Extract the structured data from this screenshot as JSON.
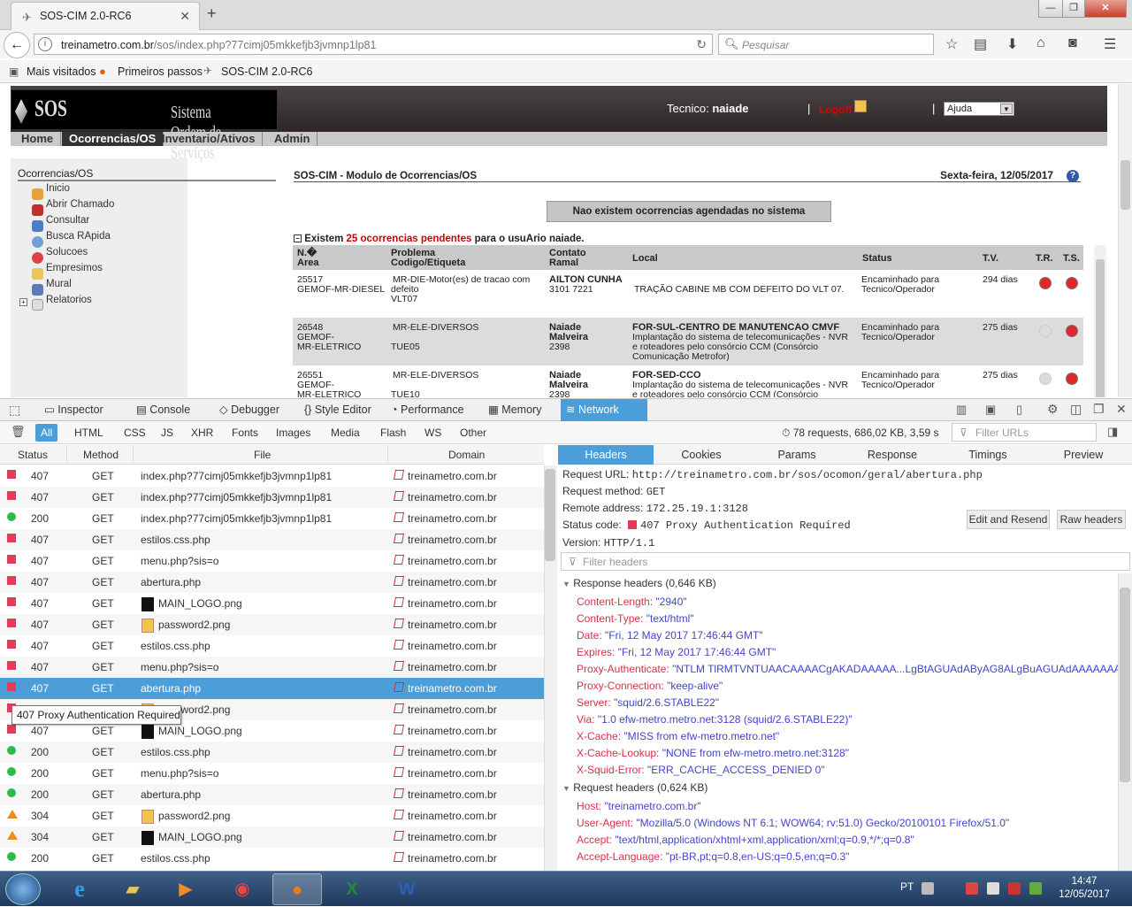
{
  "browser": {
    "tab_title": "SOS-CIM 2.0-RC6",
    "url_host": "treinametro.com.br",
    "url_path": "/sos/index.php?77cimj05mkkefjb3jvmnp1lp81",
    "search_placeholder": "Pesquisar",
    "bookmarks": [
      "Mais visitados",
      "Primeiros passos",
      "SOS-CIM 2.0-RC6"
    ]
  },
  "sos": {
    "logo_main": "SOS",
    "logo_sub": "Sistema Ordem de Serviços",
    "tecnico_label": "Tecnico:",
    "tecnico_name": "naiade",
    "sep": "|",
    "logoff": "Logoff",
    "ajuda": "Ajuda",
    "menu": [
      "Home",
      "Ocorrencias/OS",
      "Inventario/Ativos",
      "Admin"
    ],
    "left_title": "Ocorrencias/OS",
    "left_items": [
      "Inicio",
      "Abrir Chamado",
      "Consultar",
      "Busca RApida",
      "Solucoes",
      "Empresimos",
      "Mural",
      "Relatorios"
    ],
    "module_title": "SOS-CIM - Modulo de Ocorrencias/OS",
    "date": "Sexta-feira, 12/05/2017",
    "no_scheduled": "Nao existem ocorrencias agendadas no sistema",
    "existem_pre": "Existem",
    "existem_count": "25 ocorrencias pendentes",
    "existem_post": "para o usuArio naiade.",
    "table_headers": {
      "n": "N.�",
      "area": "Area",
      "problema": "Problema",
      "codigo": "Codigo/Etiqueta",
      "contato": "Contato",
      "ramal": "Ramal",
      "local": "Local",
      "status": "Status",
      "tv": "T.V.",
      "tr": "T.R.",
      "ts": "T.S."
    },
    "rows": [
      {
        "n": "25517",
        "area": "GEMOF-MR-DIESEL",
        "area2": "",
        "problema": "MR-DIE-Motor(es) de tracao com",
        "problema2": "defeito",
        "codigo": "VLT07",
        "contato": "AILTON CUNHA",
        "contato2": "",
        "ramal": "3101 7221",
        "local_title": "",
        "local": "TRAÇÃO CABINE MB COM DEFEITO DO VLT 07.",
        "local2": "",
        "local3": "",
        "status": "Encaminhado para",
        "status2": "Tecnico/Operador",
        "tv": "294 dias",
        "tr": "red",
        "ts": "red"
      },
      {
        "n": "26548",
        "area": "GEMOF-",
        "area2": "MR-ELETRICO",
        "problema": "MR-ELE-DIVERSOS",
        "problema2": "",
        "codigo": "TUE05",
        "contato": "Naiade",
        "contato2": "Malveira",
        "ramal": "2398",
        "local_title": "FOR-SUL-CENTRO DE MANUTENCAO CMVF",
        "local": "Implantação do sistema de telecomunicações - NVR",
        "local2": "e roteadores pelo consórcio CCM (Consórcio",
        "local3": "Comunicação Metrofor)",
        "status": "Encaminhado para",
        "status2": "Tecnico/Operador",
        "tv": "275 dias",
        "tr": "grey",
        "ts": "red"
      },
      {
        "n": "26551",
        "area": "GEMOF-",
        "area2": "MR-ELETRICO",
        "problema": "MR-ELE-DIVERSOS",
        "problema2": "",
        "codigo": "TUE10",
        "contato": "Naiade",
        "contato2": "Malveira",
        "ramal": "2398",
        "local_title": "FOR-SED-CCO",
        "local": "Implantação do sistema de telecomunicações - NVR",
        "local2": "e roteadores pelo consórcio CCM (Consórcio",
        "local3": "",
        "status": "Encaminhado para",
        "status2": "Tecnico/Operador",
        "tv": "275 dias",
        "tr": "grey",
        "ts": "red"
      }
    ]
  },
  "devtools": {
    "tabs": [
      "Inspector",
      "Console",
      "Debugger",
      "Style Editor",
      "Performance",
      "Memory",
      "Network"
    ],
    "filters": [
      "All",
      "HTML",
      "CSS",
      "JS",
      "XHR",
      "Fonts",
      "Images",
      "Media",
      "Flash",
      "WS",
      "Other"
    ],
    "summary": "78 requests, 686,02 KB, 3,59 s",
    "filter_urls_placeholder": "Filter URLs",
    "columns": [
      "Status",
      "Method",
      "File",
      "Domain"
    ],
    "requests": [
      {
        "status": "407",
        "method": "GET",
        "file": "index.php?77cimj05mkkefjb3jvmnp1lp81",
        "icon": "",
        "domain": "treinametro.com.br"
      },
      {
        "status": "407",
        "method": "GET",
        "file": "index.php?77cimj05mkkefjb3jvmnp1lp81",
        "icon": "",
        "domain": "treinametro.com.br"
      },
      {
        "status": "200",
        "method": "GET",
        "file": "index.php?77cimj05mkkefjb3jvmnp1lp81",
        "icon": "",
        "domain": "treinametro.com.br"
      },
      {
        "status": "407",
        "method": "GET",
        "file": "estilos.css.php",
        "icon": "",
        "domain": "treinametro.com.br"
      },
      {
        "status": "407",
        "method": "GET",
        "file": "menu.php?sis=o",
        "icon": "",
        "domain": "treinametro.com.br"
      },
      {
        "status": "407",
        "method": "GET",
        "file": "abertura.php",
        "icon": "",
        "domain": "treinametro.com.br"
      },
      {
        "status": "407",
        "method": "GET",
        "file": "MAIN_LOGO.png",
        "icon": "logo",
        "domain": "treinametro.com.br"
      },
      {
        "status": "407",
        "method": "GET",
        "file": "password2.png",
        "icon": "pw",
        "domain": "treinametro.com.br"
      },
      {
        "status": "407",
        "method": "GET",
        "file": "estilos.css.php",
        "icon": "",
        "domain": "treinametro.com.br"
      },
      {
        "status": "407",
        "method": "GET",
        "file": "menu.php?sis=o",
        "icon": "",
        "domain": "treinametro.com.br"
      },
      {
        "status": "407",
        "method": "GET",
        "file": "abertura.php",
        "icon": "",
        "domain": "treinametro.com.br"
      },
      {
        "status": "407",
        "method": "GET",
        "file": "password2.png",
        "icon": "pw",
        "domain": "treinametro.com.br"
      },
      {
        "status": "407",
        "method": "GET",
        "file": "MAIN_LOGO.png",
        "icon": "logo",
        "domain": "treinametro.com.br"
      },
      {
        "status": "200",
        "method": "GET",
        "file": "estilos.css.php",
        "icon": "",
        "domain": "treinametro.com.br"
      },
      {
        "status": "200",
        "method": "GET",
        "file": "menu.php?sis=o",
        "icon": "",
        "domain": "treinametro.com.br"
      },
      {
        "status": "200",
        "method": "GET",
        "file": "abertura.php",
        "icon": "",
        "domain": "treinametro.com.br"
      },
      {
        "status": "304",
        "method": "GET",
        "file": "password2.png",
        "icon": "pw",
        "domain": "treinametro.com.br"
      },
      {
        "status": "304",
        "method": "GET",
        "file": "MAIN_LOGO.png",
        "icon": "logo",
        "domain": "treinametro.com.br"
      },
      {
        "status": "200",
        "method": "GET",
        "file": "estilos.css.php",
        "icon": "",
        "domain": "treinametro.com.br"
      }
    ],
    "selected_index": 10,
    "tooltip": "407 Proxy Authentication Required",
    "detail_tabs": [
      "Headers",
      "Cookies",
      "Params",
      "Response",
      "Timings",
      "Preview"
    ],
    "request_url_label": "Request URL:",
    "request_url": "http://treinametro.com.br/sos/ocomon/geral/abertura.php",
    "request_method_label": "Request method:",
    "request_method": "GET",
    "remote_address_label": "Remote address:",
    "remote_address": "172.25.19.1:3128",
    "status_code_label": "Status code:",
    "status_code": "407 Proxy Authentication Required",
    "version_label": "Version:",
    "version": "HTTP/1.1",
    "edit_resend": "Edit and Resend",
    "raw_headers": "Raw headers",
    "filter_headers_placeholder": "Filter headers",
    "response_headers_title": "Response headers (0,646 KB)",
    "response_headers": [
      {
        "k": "Content-Length:",
        "v": "\"2940\""
      },
      {
        "k": "Content-Type:",
        "v": "\"text/html\""
      },
      {
        "k": "Date:",
        "v": "\"Fri, 12 May 2017 17:46:44 GMT\""
      },
      {
        "k": "Expires:",
        "v": "\"Fri, 12 May 2017 17:46:44 GMT\""
      },
      {
        "k": "Proxy-Authenticate:",
        "v": "\"NTLM TlRMTVNTUAACAAAACgAKADAAAAA...LgBtAGUAdAByAG8ALgBuAGUAdAAAAAAA\""
      },
      {
        "k": "Proxy-Connection:",
        "v": "\"keep-alive\""
      },
      {
        "k": "Server:",
        "v": "\"squid/2.6.STABLE22\""
      },
      {
        "k": "Via:",
        "v": "\"1.0 efw-metro.metro.net:3128 (squid/2.6.STABLE22)\""
      },
      {
        "k": "X-Cache:",
        "v": "\"MISS from efw-metro.metro.net\""
      },
      {
        "k": "X-Cache-Lookup:",
        "v": "\"NONE from efw-metro.metro.net:3128\""
      },
      {
        "k": "X-Squid-Error:",
        "v": "\"ERR_CACHE_ACCESS_DENIED 0\""
      }
    ],
    "request_headers_title": "Request headers (0,624 KB)",
    "request_headers": [
      {
        "k": "Host:",
        "v": "\"treinametro.com.br\""
      },
      {
        "k": "User-Agent:",
        "v": "\"Mozilla/5.0 (Windows NT 6.1; WOW64; rv:51.0) Gecko/20100101 Firefox/51.0\""
      },
      {
        "k": "Accept:",
        "v": "\"text/html,application/xhtml+xml,application/xml;q=0.9,*/*;q=0.8\""
      },
      {
        "k": "Accept-Language:",
        "v": "\"pt-BR,pt;q=0.8,en-US;q=0.5,en;q=0.3\""
      }
    ]
  },
  "taskbar": {
    "lang": "PT",
    "time": "14:47",
    "date": "12/05/2017"
  },
  "colors": {
    "accent": "#4c9ed9",
    "status_407": "#e13b5a",
    "status_200": "#2cbb4e",
    "status_304": "#e88d1e"
  }
}
